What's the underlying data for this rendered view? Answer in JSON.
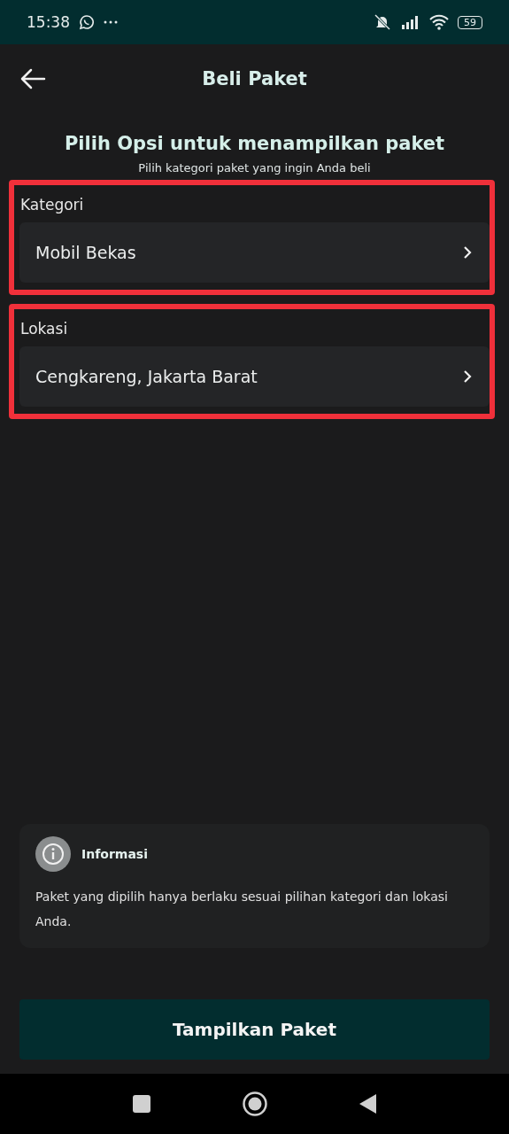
{
  "status_bar": {
    "time": "15:38",
    "battery": "59"
  },
  "header": {
    "title": "Beli Paket"
  },
  "heading": "Pilih Opsi untuk menampilkan paket",
  "subheading": "Pilih kategori paket yang ingin Anda beli",
  "fields": [
    {
      "label": "Kategori",
      "value": "Mobil Bekas",
      "highlighted": true
    },
    {
      "label": "Lokasi",
      "value": "Cengkareng, Jakarta Barat",
      "highlighted": true
    }
  ],
  "info": {
    "title": "Informasi",
    "text": "Paket yang dipilih hanya berlaku sesuai pilihan kategori dan lokasi Anda."
  },
  "button": "Tampilkan Paket"
}
